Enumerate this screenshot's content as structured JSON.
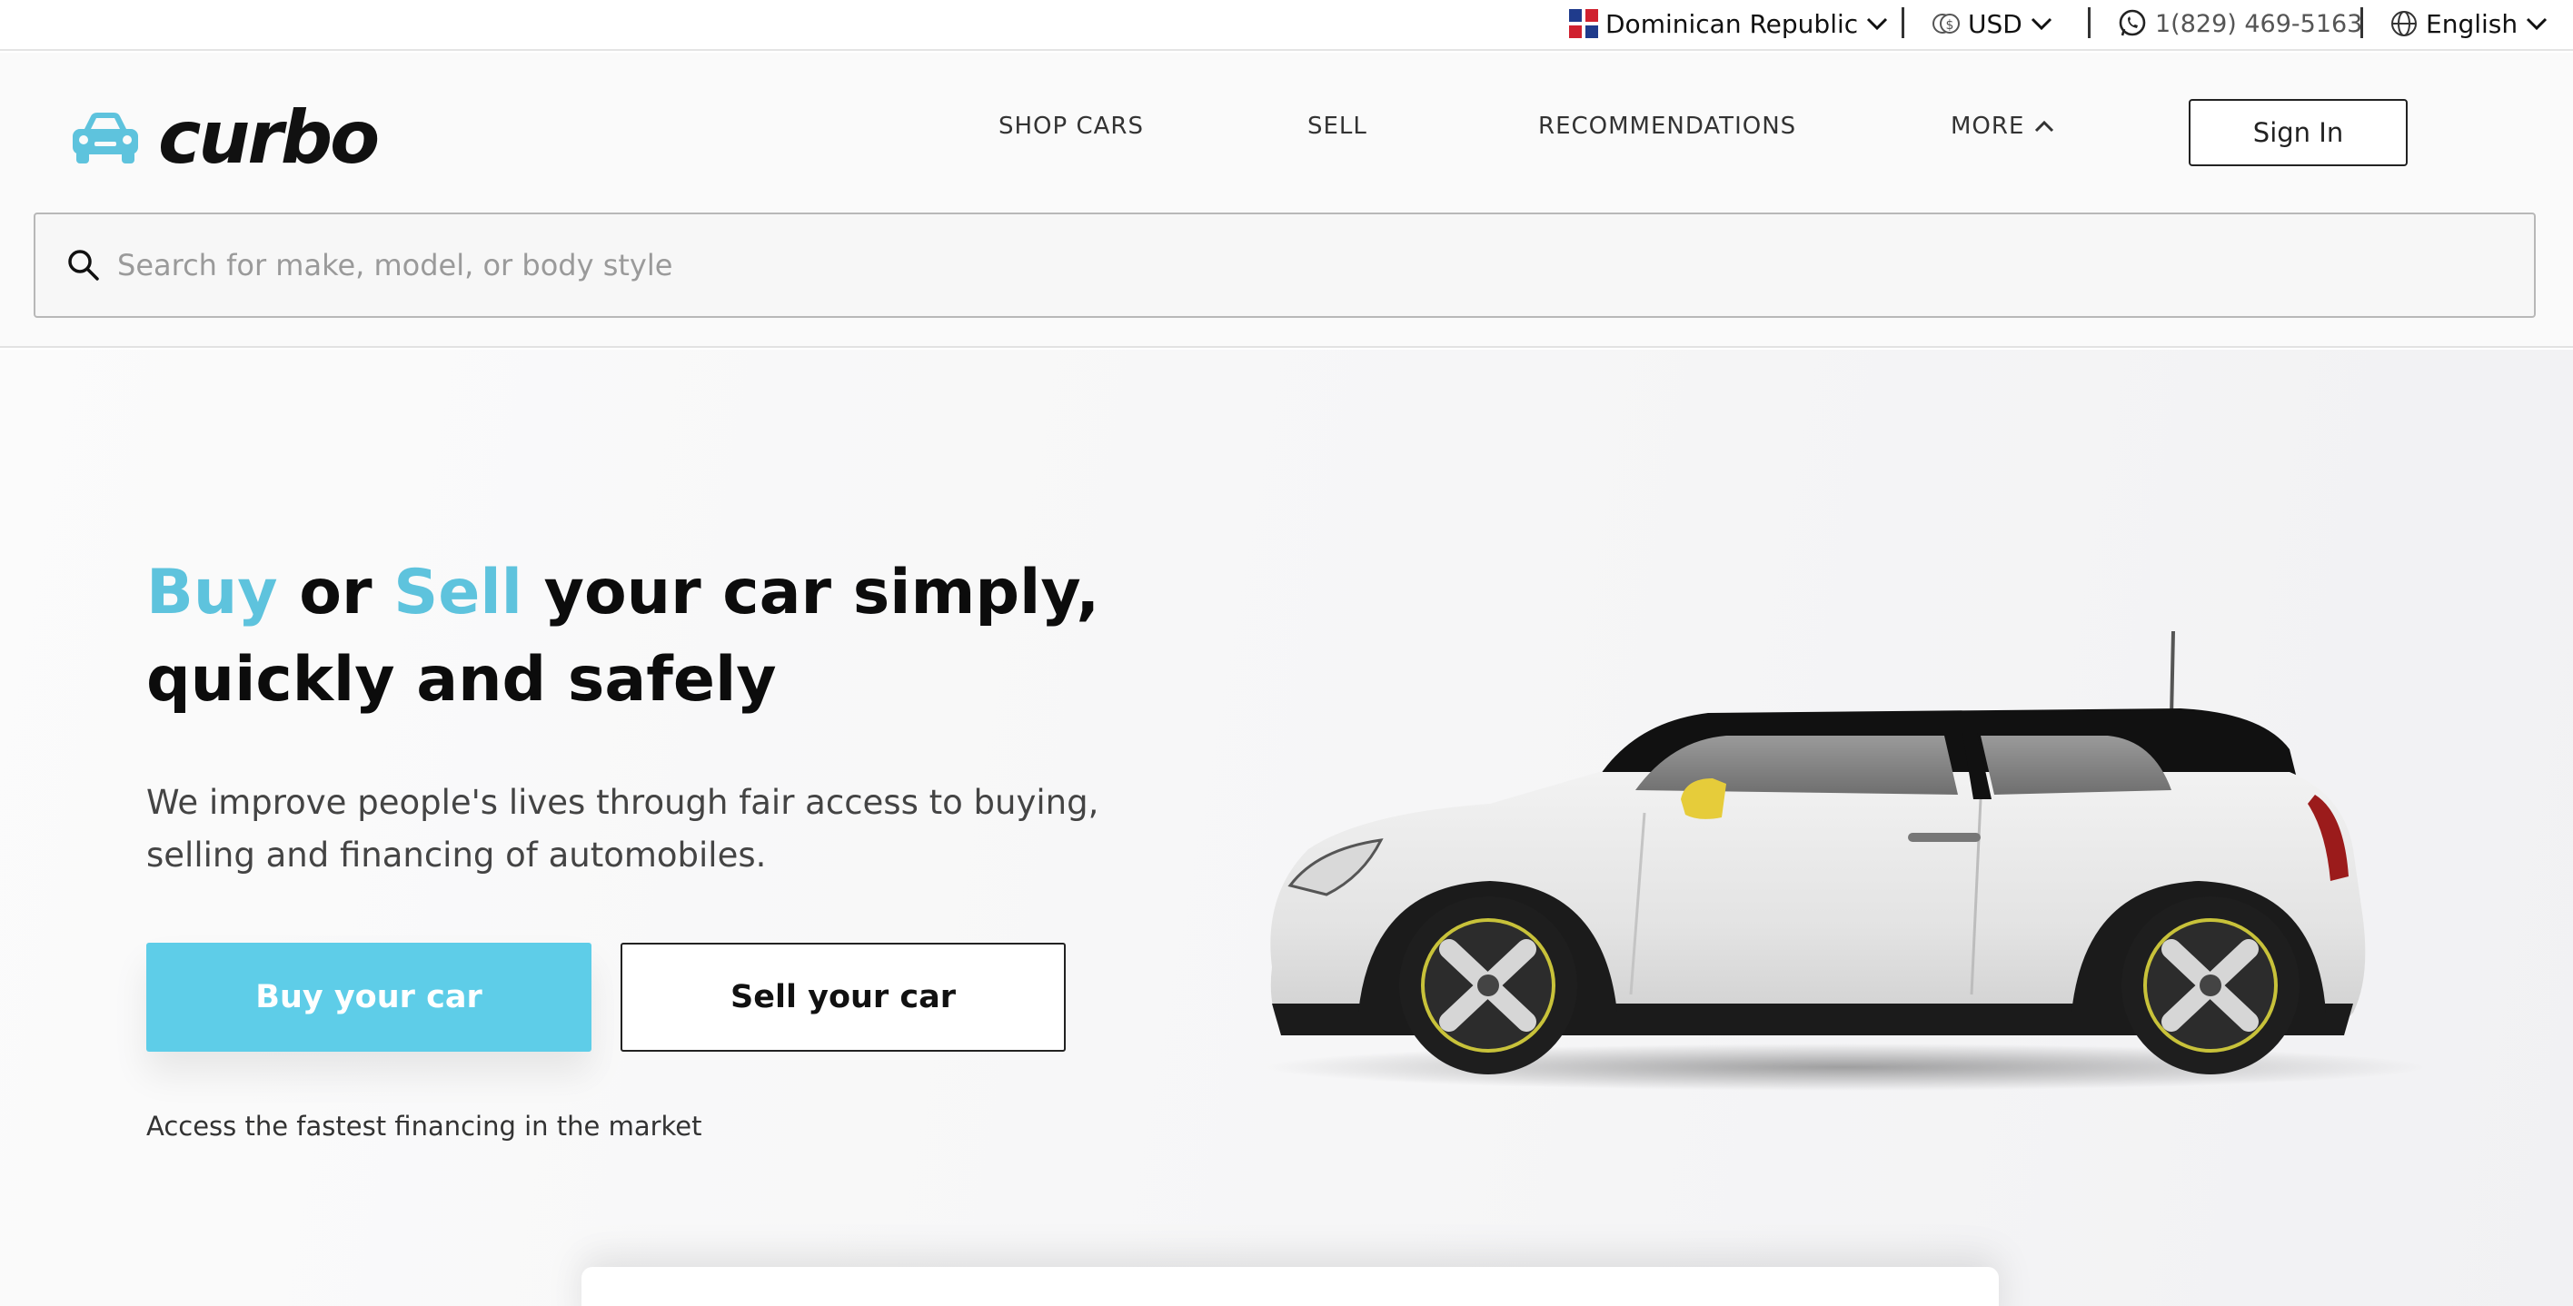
{
  "topbar": {
    "country": "Dominican Republic",
    "currency": "USD",
    "phone": "1(829) 469-5163",
    "language": "English"
  },
  "header": {
    "logo_text": "curbo",
    "nav": {
      "shop_cars": "SHOP CARS",
      "sell": "SELL",
      "recommendations": "RECOMMENDATIONS",
      "more": "MORE"
    },
    "sign_in": "Sign In",
    "search": {
      "placeholder": "Search for make, model, or body style",
      "value": ""
    }
  },
  "hero": {
    "headline": {
      "word_buy": "Buy",
      "word_or": "or",
      "word_sell": "Sell",
      "rest": "your car simply, quickly and safely"
    },
    "subtext": "We improve people's lives through fair access to buying, selling and financing of automobiles.",
    "buy_button": "Buy your car",
    "sell_button": "Sell your car",
    "finance_note": "Access the fastest financing in the market"
  },
  "colors": {
    "accent": "#5ec3dd",
    "buy_button": "#5ecde8",
    "text": "#0c0c0c"
  },
  "icons": {
    "flag": "dominican-republic-flag-icon",
    "currency": "currency-coin-icon",
    "phone": "whatsapp-icon",
    "language": "globe-icon",
    "chevron": "chevron-down-icon",
    "more": "chevron-up-icon",
    "search": "search-icon",
    "logo": "car-logo-icon"
  }
}
